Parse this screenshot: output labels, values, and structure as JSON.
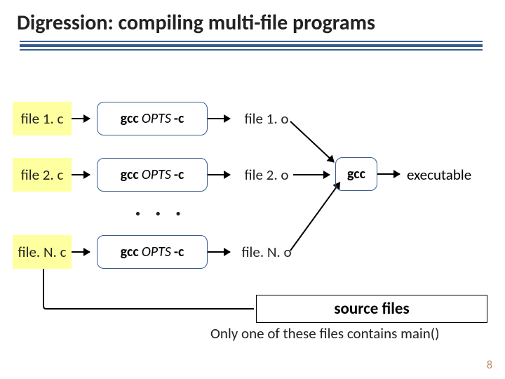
{
  "title": "Digression: compiling multi-file programs",
  "rows": [
    {
      "src": "file 1. c",
      "cmd_gcc": "gcc",
      "cmd_opts": "OPTS",
      "cmd_flag": "-c",
      "obj": "file 1. o"
    },
    {
      "src": "file 2. c",
      "cmd_gcc": "gcc",
      "cmd_opts": "OPTS",
      "cmd_flag": "-c",
      "obj": "file 2. o"
    },
    {
      "src": "file. N. c",
      "cmd_gcc": "gcc",
      "cmd_opts": "OPTS",
      "cmd_flag": "-c",
      "obj": "file. N. o"
    }
  ],
  "ellipsis": ". . .",
  "link": {
    "cmd": "gcc",
    "output": "executable"
  },
  "sourcebox": "source files",
  "note": "Only one of these files contains main()",
  "pagenum": "8"
}
